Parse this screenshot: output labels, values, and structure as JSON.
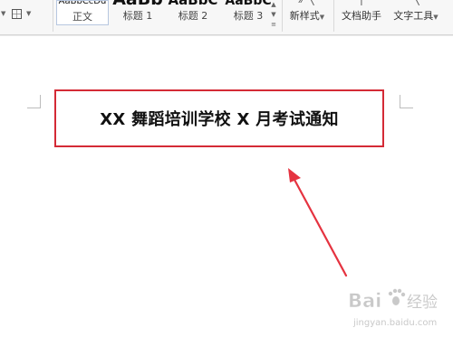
{
  "ribbon": {
    "gallery_items": [
      {
        "preview": "AaBbCcDd",
        "label": "正文",
        "selected": true
      },
      {
        "preview": "AaBb",
        "label": "标题 1",
        "selected": false
      },
      {
        "preview": "AaBbC",
        "label": "标题 2",
        "selected": false
      },
      {
        "preview": "AaBbC",
        "label": "标题 3",
        "selected": false
      }
    ],
    "new_style_label": "新样式",
    "doc_helper_label": "文档助手",
    "text_tools_label": "文字工具"
  },
  "document": {
    "title": "XX 舞蹈培训学校 X 月考试通知"
  },
  "annotation": {
    "arrow_color": "#e53340",
    "box_color": "#d42a36"
  },
  "watermark": {
    "brand": "Bai",
    "brand_suffix": "经验",
    "url": "jingyan.baidu.com"
  }
}
